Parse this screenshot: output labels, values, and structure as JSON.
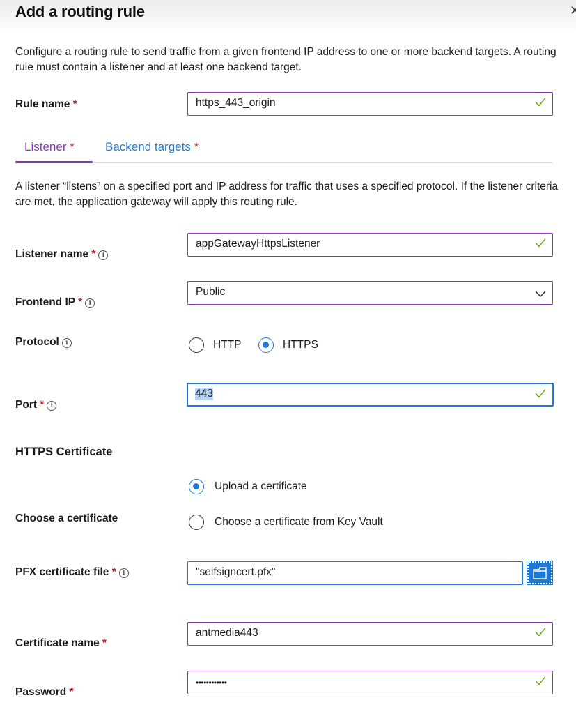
{
  "header": {
    "title": "Add a routing rule",
    "close_icon": "close-icon"
  },
  "intro": "Configure a routing rule to send traffic from a given frontend IP address to one or more backend targets. A routing rule must contain a listener and at least one backend target.",
  "rule_name": {
    "label": "Rule name",
    "required": "*",
    "value": "https_443_origin",
    "valid": true
  },
  "tabs": [
    {
      "label": "Listener",
      "required": "*",
      "active": true
    },
    {
      "label": "Backend targets",
      "required": "*",
      "active": false
    }
  ],
  "listener": {
    "description": "A listener “listens” on a specified port and IP address for traffic that uses a specified protocol. If the listener criteria are met, the application gateway will apply this routing rule.",
    "listener_name": {
      "label": "Listener name",
      "required": "*",
      "value": "appGatewayHttpsListener",
      "valid": true
    },
    "frontend_ip": {
      "label": "Frontend IP",
      "required": "*",
      "selected": "Public"
    },
    "protocol": {
      "label": "Protocol",
      "options": [
        {
          "label": "HTTP",
          "selected": false
        },
        {
          "label": "HTTPS",
          "selected": true
        }
      ]
    },
    "port": {
      "label": "Port",
      "required": "*",
      "value": "443",
      "valid": true,
      "focused": true
    }
  },
  "https_certificate": {
    "heading": "HTTPS Certificate",
    "choose": {
      "label": "Choose a certificate",
      "options": [
        {
          "label": "Upload a certificate",
          "selected": true
        },
        {
          "label": "Choose a certificate from Key Vault",
          "selected": false
        }
      ]
    },
    "pfx_file": {
      "label": "PFX certificate file",
      "required": "*",
      "value": "\"selfsigncert.pfx\"",
      "browse_icon": "folder-icon"
    },
    "certificate_name": {
      "label": "Certificate name",
      "required": "*",
      "value": "antmedia443",
      "valid": true
    },
    "password": {
      "label": "Password",
      "required": "*",
      "value": "••••••••••••",
      "valid": true
    }
  },
  "colors": {
    "accent_purple": "#8a3ab9",
    "link_blue": "#1d78d6",
    "required_red": "#a4262c",
    "valid_green": "#57a300"
  }
}
